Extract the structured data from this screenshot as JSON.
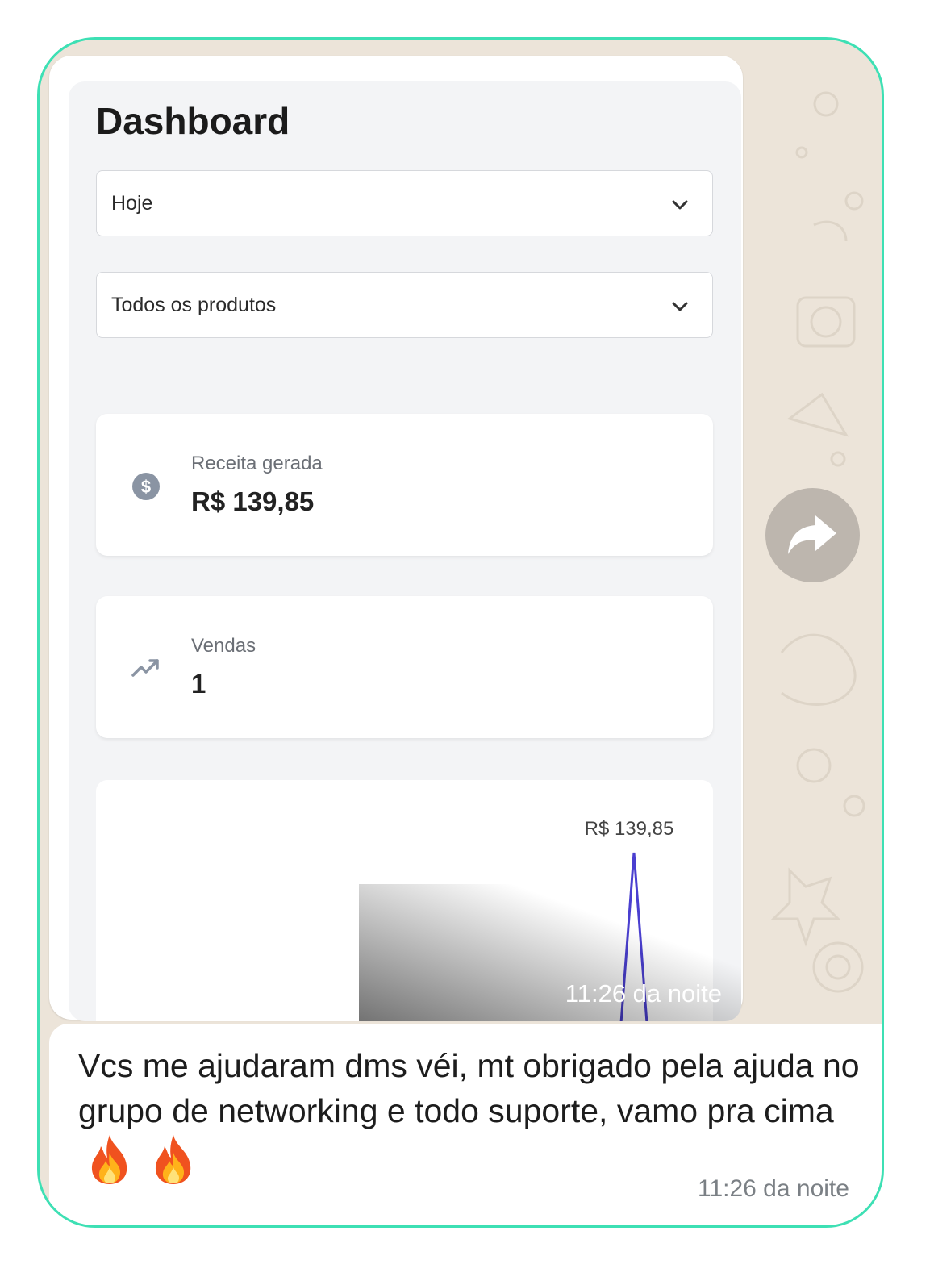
{
  "dashboard": {
    "title": "Dashboard",
    "period_select": {
      "value": "Hoje"
    },
    "product_select": {
      "value": "Todos os produtos"
    },
    "revenue_card": {
      "label": "Receita gerada",
      "value": "R$ 139,85",
      "icon": "dollar-coin-icon"
    },
    "sales_card": {
      "label": "Vendas",
      "value": "1",
      "icon": "trending-up-icon"
    },
    "chart_data": {
      "type": "line",
      "series": [
        {
          "values": [
            0,
            139.85,
            0
          ]
        }
      ],
      "data_labels": [
        "R$ 139,85"
      ],
      "line_color": "#4a3fd0"
    }
  },
  "image_message": {
    "timestamp": "11:26 da noite"
  },
  "forward_button": {
    "icon": "forward-arrow-icon"
  },
  "text_message": {
    "text": "Vcs me ajudaram dms véi, mt obrigado pela ajuda no grupo de networking e todo suporte, vamo pra cima",
    "emojis": [
      "fire-emoji",
      "fire-emoji"
    ],
    "timestamp": "11:26 da noite"
  },
  "colors": {
    "frame_border": "#3de0b4",
    "chat_wallpaper": "#ece4d9",
    "chart_line": "#4a3fd0"
  }
}
